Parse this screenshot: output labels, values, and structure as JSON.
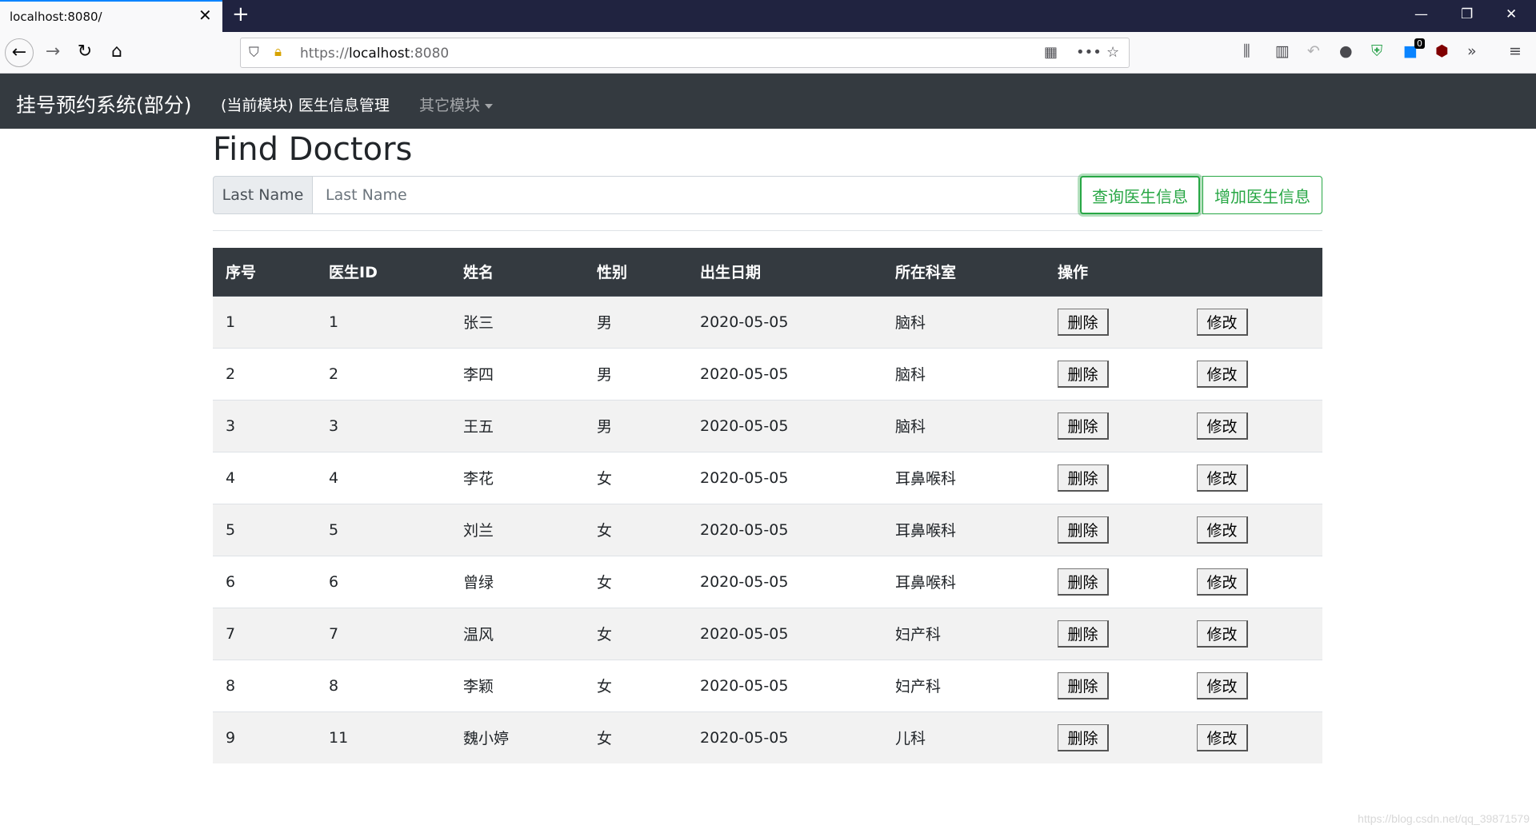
{
  "browser": {
    "tab_title": "localhost:8080/",
    "url_scheme": "https://",
    "url_host": "localhost",
    "url_port": ":8080",
    "badge_count": "0"
  },
  "app": {
    "brand": "挂号预约系统(部分)",
    "nav_current": "(当前模块) 医生信息管理",
    "nav_other": "其它模块"
  },
  "page": {
    "heading": "Find Doctors",
    "search_label": "Last Name",
    "search_placeholder": "Last Name",
    "search_button": "查询医生信息",
    "add_button": "增加医生信息"
  },
  "table": {
    "headers": [
      "序号",
      "医生ID",
      "姓名",
      "性别",
      "出生日期",
      "所在科室",
      "操作",
      ""
    ],
    "delete_label": "删除",
    "edit_label": "修改",
    "rows": [
      [
        "1",
        "1",
        "张三",
        "男",
        "2020-05-05",
        "脑科"
      ],
      [
        "2",
        "2",
        "李四",
        "男",
        "2020-05-05",
        "脑科"
      ],
      [
        "3",
        "3",
        "王五",
        "男",
        "2020-05-05",
        "脑科"
      ],
      [
        "4",
        "4",
        "李花",
        "女",
        "2020-05-05",
        "耳鼻喉科"
      ],
      [
        "5",
        "5",
        "刘兰",
        "女",
        "2020-05-05",
        "耳鼻喉科"
      ],
      [
        "6",
        "6",
        "曾绿",
        "女",
        "2020-05-05",
        "耳鼻喉科"
      ],
      [
        "7",
        "7",
        "温风",
        "女",
        "2020-05-05",
        "妇产科"
      ],
      [
        "8",
        "8",
        "李颖",
        "女",
        "2020-05-05",
        "妇产科"
      ],
      [
        "9",
        "11",
        "魏小婷",
        "女",
        "2020-05-05",
        "儿科"
      ]
    ]
  },
  "watermark": "https://blog.csdn.net/qq_39871579",
  "colors": {
    "navbar": "#343a40",
    "success": "#28a745",
    "tabbar": "#202340"
  }
}
